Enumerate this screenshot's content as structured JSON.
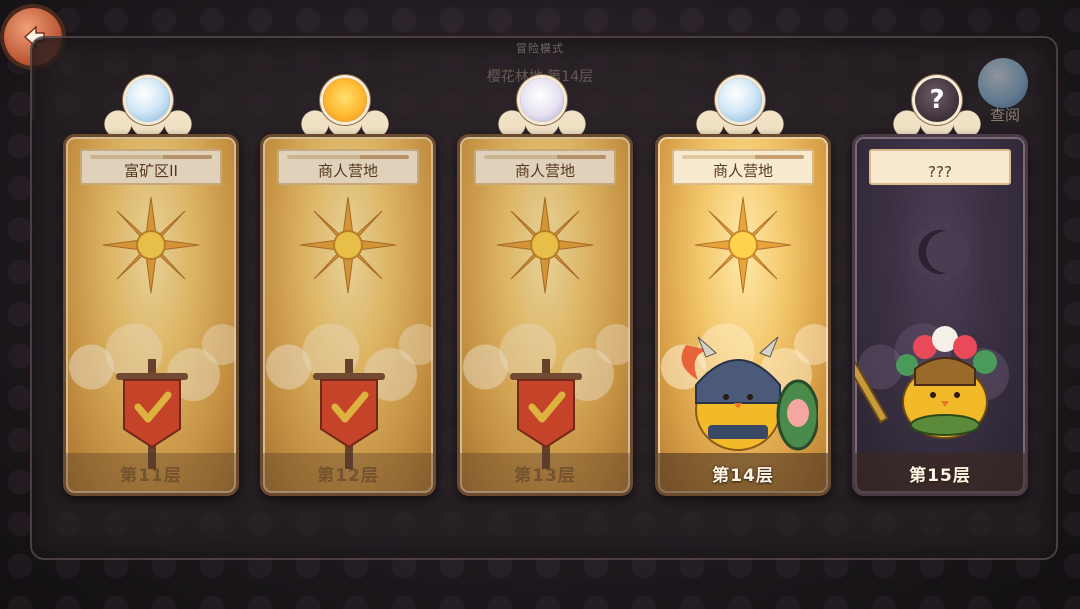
{
  "header": {
    "mode_label": "冒险模式",
    "subtitle": "樱花林地 第14层"
  },
  "top_right": {
    "label": "查阅"
  },
  "cards": [
    {
      "name": "富矿区II",
      "floor": "第11层",
      "state": "cleared",
      "orb": "ice-orb-icon"
    },
    {
      "name": "商人营地",
      "floor": "第12层",
      "state": "cleared",
      "orb": "sun-orb-icon"
    },
    {
      "name": "商人营地",
      "floor": "第13层",
      "state": "cleared",
      "orb": "ghost-orb-icon"
    },
    {
      "name": "商人营地",
      "floor": "第14层",
      "state": "current",
      "orb": "ice-orb-icon"
    },
    {
      "name": "???",
      "floor": "第15层",
      "state": "locked",
      "orb": "question-mark-icon",
      "orb_text": "?"
    }
  ],
  "colors": {
    "card_gold": "#f3c86d",
    "card_dark": "#3a3042",
    "banner_red": "#d9482b",
    "check": "#f5c542"
  }
}
